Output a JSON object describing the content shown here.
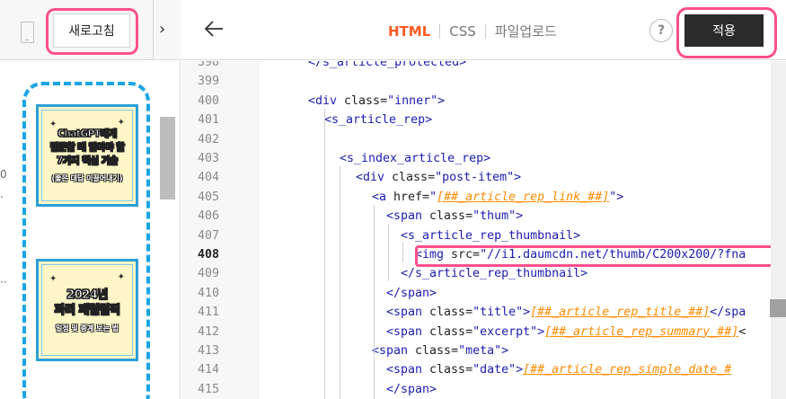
{
  "left": {
    "refresh_label": "새로고침",
    "collapse_icon": "chevron-right-icon",
    "stray_marks": [
      "0",
      ".",
      "··"
    ],
    "thumbnails": [
      {
        "lines": [
          "ChatGPT에게",
          "질문할 때 알아야 할",
          "7가지 핵심 기술"
        ],
        "sub": "(좋은 대답 이끌어내기)"
      },
      {
        "lines": [
          "2024년",
          "파리 패럴림픽"
        ],
        "sub": "일정 및 중계 보는 법"
      }
    ]
  },
  "editor": {
    "tabs": [
      "HTML",
      "CSS",
      "파일업로드"
    ],
    "active_tab": "HTML",
    "help_label": "?",
    "apply_label": "적용",
    "lines": [
      {
        "n": "398",
        "text": "</s_article_protected>"
      },
      {
        "n": "399",
        "text": ""
      },
      {
        "n": "400",
        "text": "<div class=\"inner\">"
      },
      {
        "n": "401",
        "text": "<s_article_rep>"
      },
      {
        "n": "402",
        "text": ""
      },
      {
        "n": "403",
        "text": "<s_index_article_rep>"
      },
      {
        "n": "404",
        "text": "<div class=\"post-item\">"
      },
      {
        "n": "405",
        "text": "<a href=\"[##_article_rep_link_##]\">"
      },
      {
        "n": "406",
        "text": "<span class=\"thum\">"
      },
      {
        "n": "407",
        "text": "<s_article_rep_thumbnail>"
      },
      {
        "n": "408",
        "text": "<img src=\"//i1.daumcdn.net/thumb/C200x200/?fna"
      },
      {
        "n": "409",
        "text": "</s_article_rep_thumbnail>"
      },
      {
        "n": "410",
        "text": "</span>"
      },
      {
        "n": "411",
        "text": "<span class=\"title\">[##_article_rep_title_##]</spa"
      },
      {
        "n": "412",
        "text": "<span class=\"excerpt\">[##_article_rep_summary_##]<"
      },
      {
        "n": "413",
        "text": "<span class=\"meta\">"
      },
      {
        "n": "414",
        "text": "<span class=\"date\">[##_article_rep_simple_date_#"
      },
      {
        "n": "415",
        "text": "</span>"
      }
    ]
  },
  "colors": {
    "highlight": "#ff4f8e",
    "dashed_frame": "#1aa5e6",
    "active_tab": "#ff5a1f",
    "apply_bg": "#2b2b2b",
    "template_var": "#ff8a00"
  }
}
